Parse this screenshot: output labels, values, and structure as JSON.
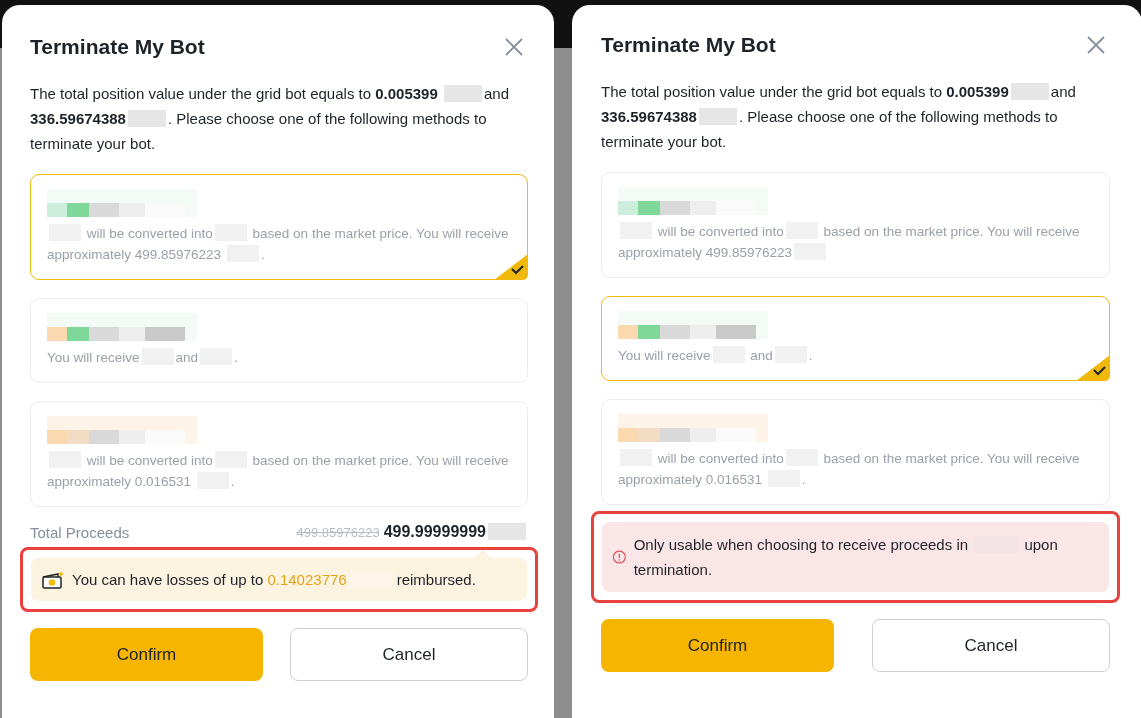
{
  "dialogs": [
    {
      "title": "Terminate My Bot",
      "intro": [
        {
          "kind": "text",
          "text": "The total position value under the grid bot equals to **0.005399** "
        },
        {
          "kind": "redacted"
        },
        {
          "kind": "text",
          "text": "and **336.59674388**"
        },
        {
          "kind": "redacted"
        },
        {
          "kind": "text",
          "text": ". Please choose one of the following methods to terminate your bot."
        }
      ],
      "options": [
        {
          "selected": true,
          "description": [
            {
              "kind": "redacted"
            },
            {
              "kind": "text",
              "text": " will be converted into"
            },
            {
              "kind": "redacted"
            },
            {
              "kind": "text",
              "text": " based on the market price. You will receive approximately 499.85976223 "
            },
            {
              "kind": "redacted"
            },
            {
              "kind": "text",
              "text": "."
            }
          ]
        },
        {
          "selected": false,
          "description": [
            {
              "kind": "text",
              "text": "You will receive"
            },
            {
              "kind": "redacted"
            },
            {
              "kind": "text",
              "text": "and"
            },
            {
              "kind": "redacted"
            },
            {
              "kind": "text",
              "text": "."
            }
          ]
        },
        {
          "selected": false,
          "description": [
            {
              "kind": "redacted"
            },
            {
              "kind": "text",
              "text": " will be converted into"
            },
            {
              "kind": "redacted"
            },
            {
              "kind": "text",
              "text": " based on the market price. You will receive approximately 0.016531 "
            },
            {
              "kind": "redacted"
            },
            {
              "kind": "text",
              "text": "."
            }
          ]
        }
      ],
      "total_proceeds": {
        "label": "Total Proceeds",
        "original": "499.85976223",
        "value": "499.99999999"
      },
      "note": {
        "kind": "reimburse",
        "parts": [
          {
            "kind": "text",
            "text": "You can have losses of up to "
          },
          {
            "kind": "amount",
            "text": "0.14023776"
          },
          {
            "kind": "redacted"
          },
          {
            "kind": "text",
            "text": "reimbursed."
          }
        ]
      },
      "buttons": [
        {
          "kind": "primary",
          "label": "Confirm"
        },
        {
          "kind": "secondary",
          "label": "Cancel"
        }
      ]
    },
    {
      "title": "Terminate My Bot",
      "intro": [
        {
          "kind": "text",
          "text": "The total position value under the grid bot equals to **0.005399**"
        },
        {
          "kind": "redacted"
        },
        {
          "kind": "text",
          "text": "and **336.59674388**"
        },
        {
          "kind": "redacted"
        },
        {
          "kind": "text",
          "text": ". Please choose one of the following methods to terminate your bot."
        }
      ],
      "options": [
        {
          "selected": false,
          "description": [
            {
              "kind": "redacted"
            },
            {
              "kind": "text",
              "text": " will be converted into"
            },
            {
              "kind": "redacted"
            },
            {
              "kind": "text",
              "text": " based on the market price. You will receive approximately 499.85976223"
            },
            {
              "kind": "redacted"
            }
          ]
        },
        {
          "selected": true,
          "description": [
            {
              "kind": "text",
              "text": "You will receive"
            },
            {
              "kind": "redacted"
            },
            {
              "kind": "text",
              "text": " and"
            },
            {
              "kind": "redacted"
            },
            {
              "kind": "text",
              "text": "."
            }
          ]
        },
        {
          "selected": false,
          "description": [
            {
              "kind": "redacted"
            },
            {
              "kind": "text",
              "text": " will be converted into"
            },
            {
              "kind": "redacted"
            },
            {
              "kind": "text",
              "text": " based on the market price. You will receive approximately 0.016531 "
            },
            {
              "kind": "redacted"
            },
            {
              "kind": "text",
              "text": "."
            }
          ]
        }
      ],
      "note": {
        "kind": "warning",
        "parts": [
          {
            "kind": "text",
            "text": "Only usable when choosing to receive proceeds in "
          },
          {
            "kind": "redacted"
          },
          {
            "kind": "text",
            "text": " upon termination."
          }
        ]
      },
      "buttons": [
        {
          "kind": "primary",
          "label": "Confirm"
        },
        {
          "kind": "secondary",
          "label": "Cancel"
        }
      ]
    }
  ]
}
